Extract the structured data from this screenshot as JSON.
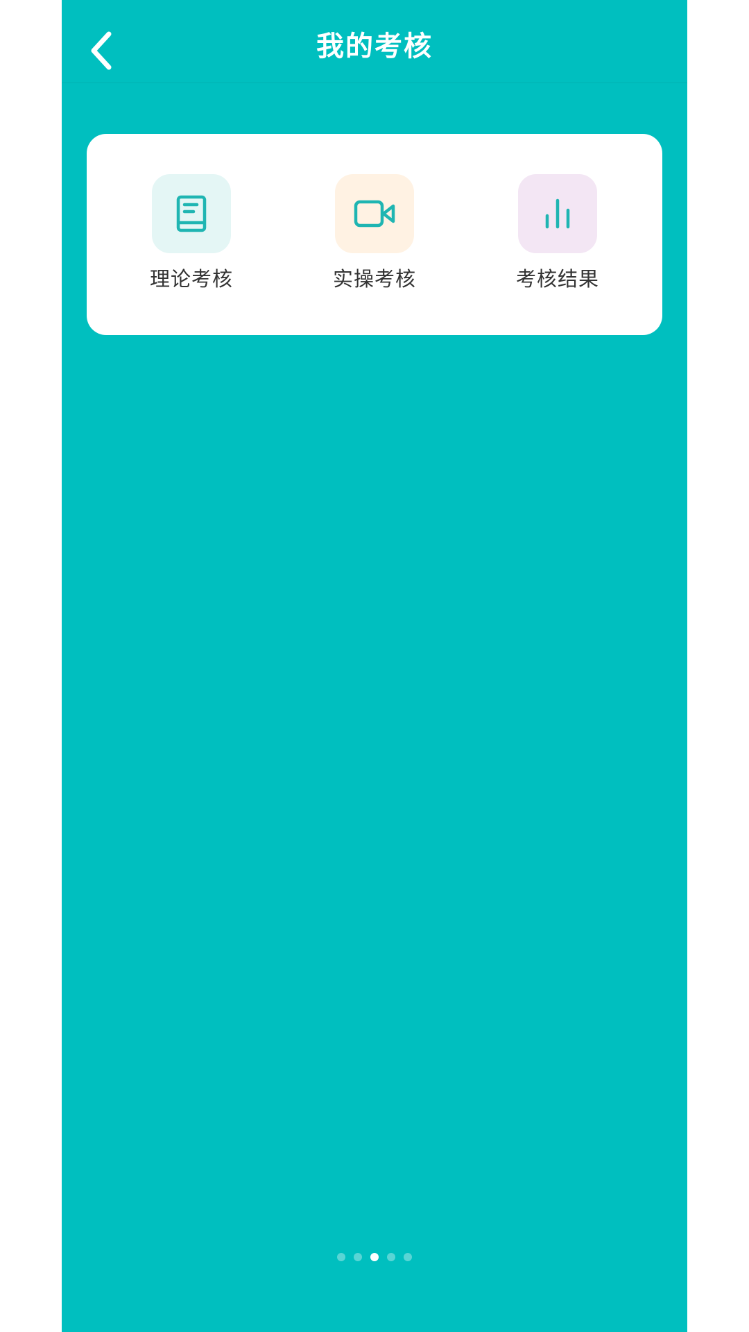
{
  "header": {
    "title": "我的考核",
    "back_icon": "chevron-left-icon"
  },
  "colors": {
    "background": "#00bfbf",
    "card": "#ffffff",
    "icon_accent": "#1fb5b2",
    "tile_theory_bg": "#e4f6f5",
    "tile_practical_bg": "#fff2e3",
    "tile_result_bg": "#f3e6f4"
  },
  "menu": {
    "items": [
      {
        "label": "理论考核",
        "icon": "book-icon"
      },
      {
        "label": "实操考核",
        "icon": "video-camera-icon"
      },
      {
        "label": "考核结果",
        "icon": "bar-chart-icon"
      }
    ]
  },
  "pagination": {
    "count": 5,
    "active_index": 2
  }
}
